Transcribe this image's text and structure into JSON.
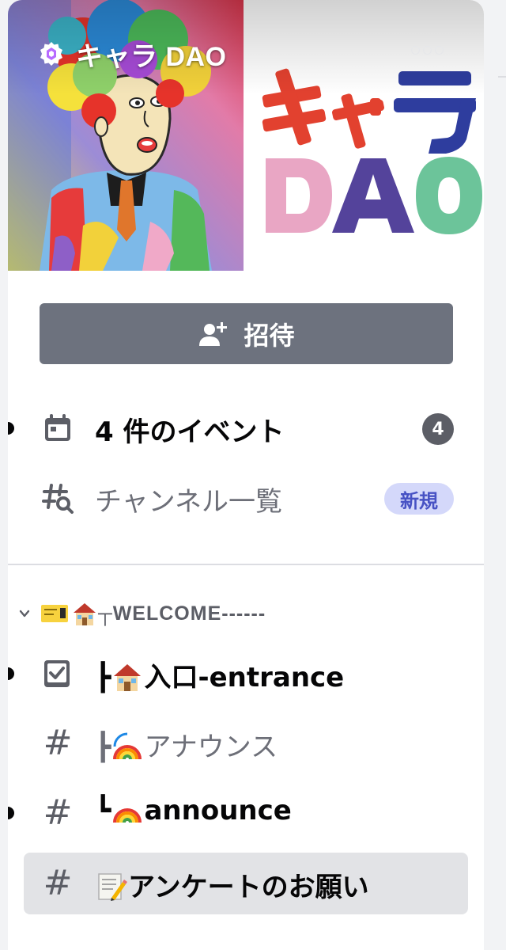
{
  "server": {
    "name": "キャラ DAO",
    "logo_text_top": "キャラ",
    "logo_text_bottom": "DAO"
  },
  "invite": {
    "label": "招待",
    "icon": "add-user-icon"
  },
  "events": {
    "label": "4 件のイベント",
    "count": "4",
    "unread": true,
    "icon": "calendar-icon"
  },
  "browse": {
    "label": "チャンネル一覧",
    "badge": "新規",
    "icon": "channel-browse-icon"
  },
  "category": {
    "label": "┬WELCOME------",
    "emoji": [
      "ticket-icon",
      "house-icon"
    ],
    "collapsed": false
  },
  "channels": [
    {
      "prefix": "┣",
      "emoji": "house-icon",
      "name": "入口-entrance",
      "type": "rules",
      "unread": true,
      "bold": true,
      "selected": false
    },
    {
      "prefix": "┣",
      "emoji": "rainbow-icon",
      "name": "アナウンス",
      "type": "text",
      "unread": false,
      "bold": false,
      "selected": false
    },
    {
      "prefix": "┗",
      "emoji": "rainbow-icon",
      "name": "announce",
      "type": "text",
      "unread": true,
      "bold": true,
      "selected": false
    },
    {
      "prefix": "",
      "emoji": "memo-icon",
      "name": "アンケートのお願い",
      "type": "text",
      "unread": false,
      "bold": true,
      "selected": true
    }
  ],
  "colors": {
    "panel_bg": "#ffffff",
    "app_bg": "#f2f3f5",
    "invite_button": "#6d727e",
    "new_badge_bg": "#d4d8fa",
    "new_badge_text": "#4752c4",
    "logo_red": "#e2412f",
    "logo_blue": "#2e3d9e",
    "logo_pink": "#e9a6c4",
    "logo_purple": "#54439b",
    "logo_green": "#6cc49a"
  }
}
